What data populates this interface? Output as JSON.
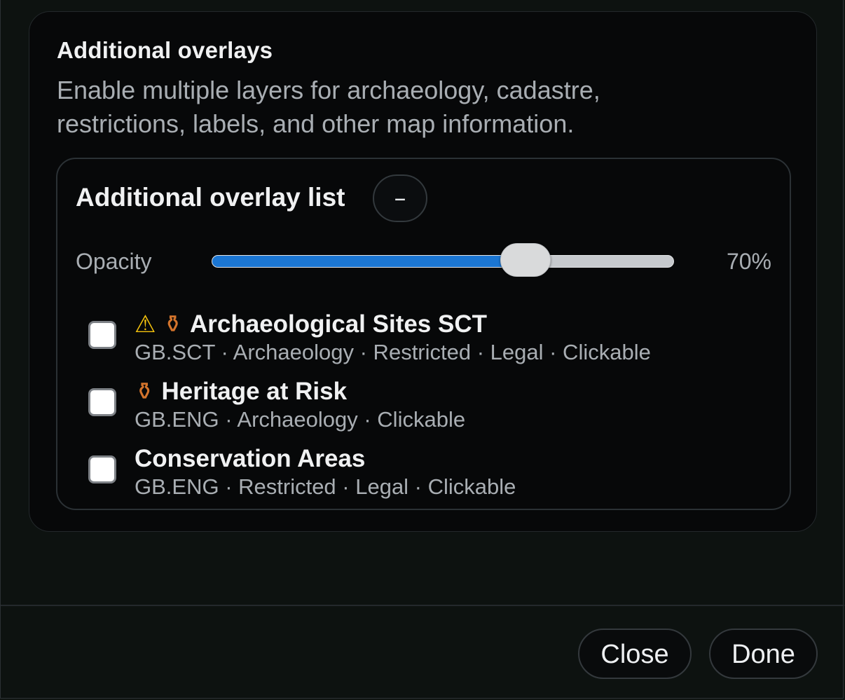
{
  "section": {
    "title": "Additional overlays",
    "description": "Enable multiple layers for archaeology, cadastre, restrictions, labels, and other map information."
  },
  "overlay_list": {
    "title": "Additional overlay list",
    "collapse_symbol": "–",
    "opacity": {
      "label": "Opacity",
      "value": 0.7,
      "value_text": "70%"
    },
    "items": [
      {
        "checked": false,
        "icons": [
          "warning-icon",
          "amphora-icon"
        ],
        "name": "Archaeological Sites SCT",
        "meta": "GB.SCT · Archaeology · Restricted · Legal · Clickable"
      },
      {
        "checked": false,
        "icons": [
          "amphora-icon"
        ],
        "name": "Heritage at Risk",
        "meta": "GB.ENG · Archaeology · Clickable"
      },
      {
        "checked": false,
        "icons": [],
        "name": "Conservation Areas",
        "meta": "GB.ENG · Restricted · Legal · Clickable"
      }
    ]
  },
  "footer": {
    "close_label": "Close",
    "done_label": "Done"
  },
  "colors": {
    "accent": "#1b76d3",
    "panel_background": "#070809",
    "text_primary": "#f0f1f2",
    "text_secondary": "#a9aeb3"
  }
}
